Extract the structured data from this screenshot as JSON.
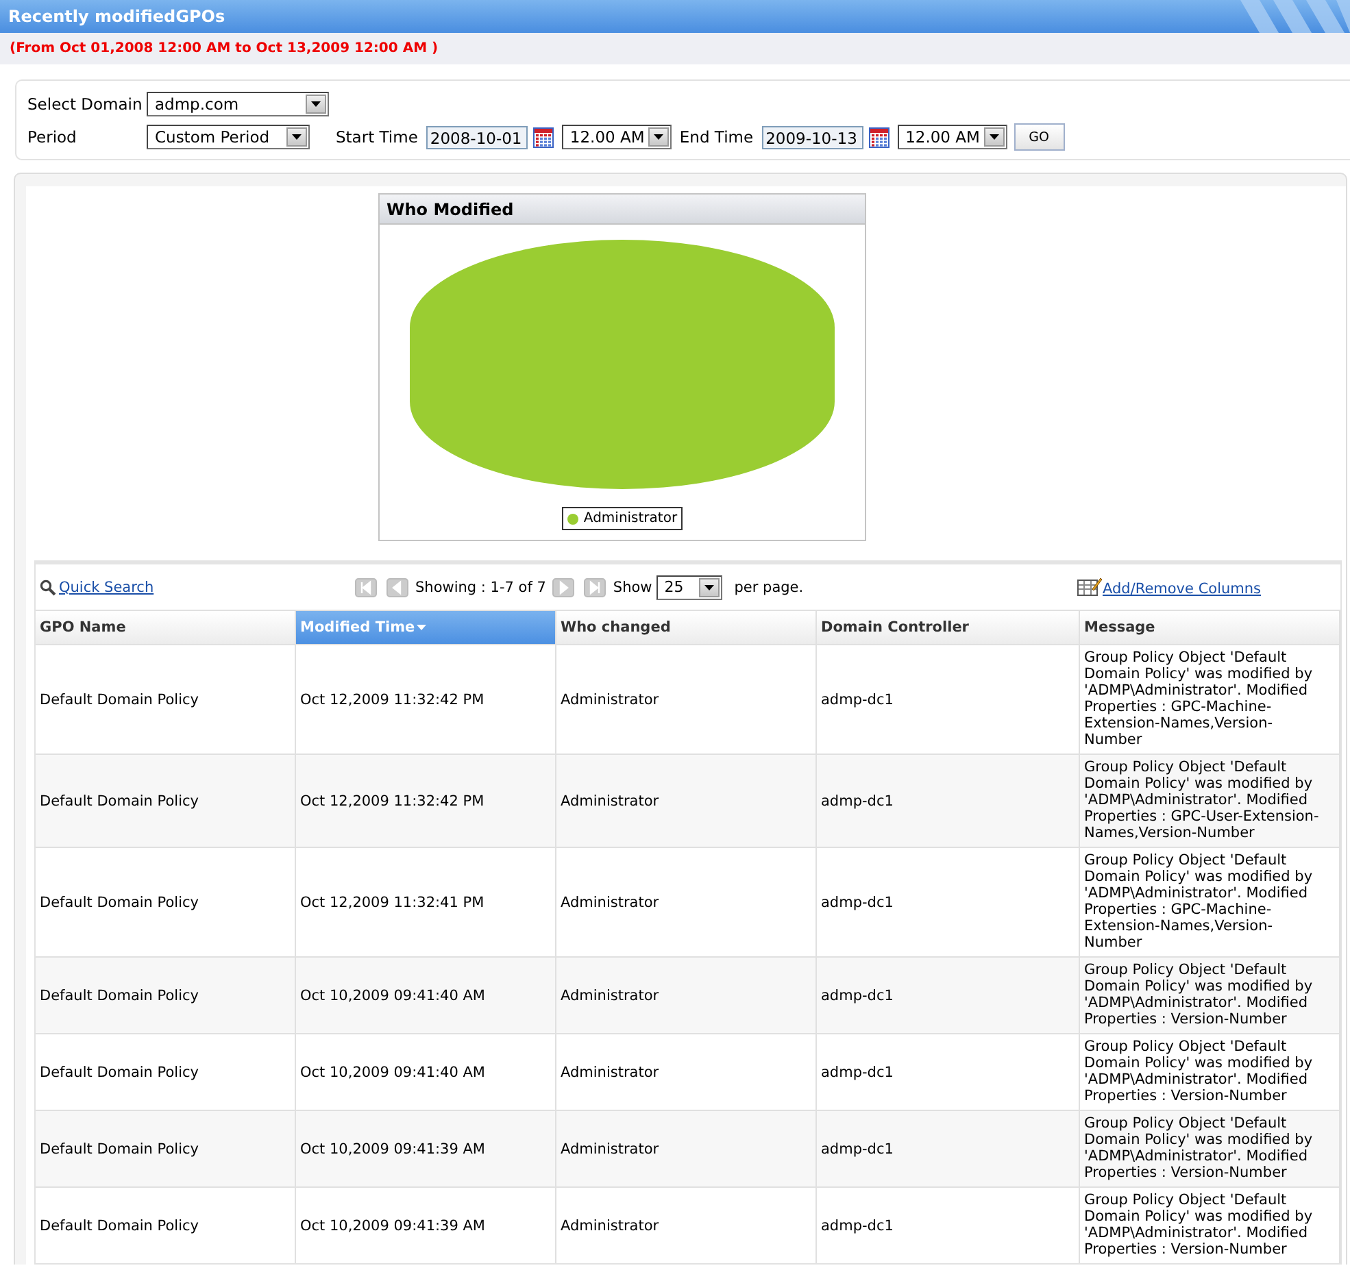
{
  "window": {
    "title": "Recently modifiedGPOs"
  },
  "date_range": "(From Oct 01,2008 12:00 AM to Oct 13,2009 12:00 AM )",
  "filters": {
    "domain_label": "Select Domain",
    "domain": "admp.com",
    "period_label": "Period",
    "period": "Custom Period",
    "start_label": "Start Time",
    "start_date": "2008-10-01",
    "start_time": "12.00 AM",
    "end_label": "End Time",
    "end_date": "2009-10-13",
    "end_time": "12.00 AM",
    "go": "GO"
  },
  "chart": {
    "title": "Who Modified",
    "legend": [
      {
        "label": "Administrator",
        "color": "#9acd32"
      }
    ]
  },
  "toolbar": {
    "quick_search": "Quick Search",
    "showing": "Showing : 1-7 of 7",
    "show_label": "Show",
    "page_size": "25",
    "per_page": "per page.",
    "columns_link": "Add/Remove Columns"
  },
  "table": {
    "columns": [
      {
        "label": "GPO Name",
        "sorted": false
      },
      {
        "label": "Modified Time",
        "sorted": true
      },
      {
        "label": "Who changed",
        "sorted": false
      },
      {
        "label": "Domain Controller",
        "sorted": false
      },
      {
        "label": "Message",
        "sorted": false
      }
    ],
    "rows": [
      [
        "Default Domain Policy",
        "Oct 12,2009 11:32:42 PM",
        "Administrator",
        "admp-dc1",
        "Group Policy Object 'Default Domain Policy' was modified by 'ADMP\\Administrator'. Modified Properties : GPC-Machine-Extension-Names,Version-Number"
      ],
      [
        "Default Domain Policy",
        "Oct 12,2009 11:32:42 PM",
        "Administrator",
        "admp-dc1",
        "Group Policy Object 'Default Domain Policy' was modified by 'ADMP\\Administrator'. Modified Properties : GPC-User-Extension-Names,Version-Number"
      ],
      [
        "Default Domain Policy",
        "Oct 12,2009 11:32:41 PM",
        "Administrator",
        "admp-dc1",
        "Group Policy Object 'Default Domain Policy' was modified by 'ADMP\\Administrator'. Modified Properties : GPC-Machine-Extension-Names,Version-Number"
      ],
      [
        "Default Domain Policy",
        "Oct 10,2009 09:41:40 AM",
        "Administrator",
        "admp-dc1",
        "Group Policy Object 'Default Domain Policy' was modified by 'ADMP\\Administrator'. Modified Properties : Version-Number"
      ],
      [
        "Default Domain Policy",
        "Oct 10,2009 09:41:40 AM",
        "Administrator",
        "admp-dc1",
        "Group Policy Object 'Default Domain Policy' was modified by 'ADMP\\Administrator'. Modified Properties : Version-Number"
      ],
      [
        "Default Domain Policy",
        "Oct 10,2009 09:41:39 AM",
        "Administrator",
        "admp-dc1",
        "Group Policy Object 'Default Domain Policy' was modified by 'ADMP\\Administrator'. Modified Properties : Version-Number"
      ],
      [
        "Default Domain Policy",
        "Oct 10,2009 09:41:39 AM",
        "Administrator",
        "admp-dc1",
        "Group Policy Object 'Default Domain Policy' was modified by 'ADMP\\Administrator'. Modified Properties : Version-Number"
      ]
    ]
  }
}
